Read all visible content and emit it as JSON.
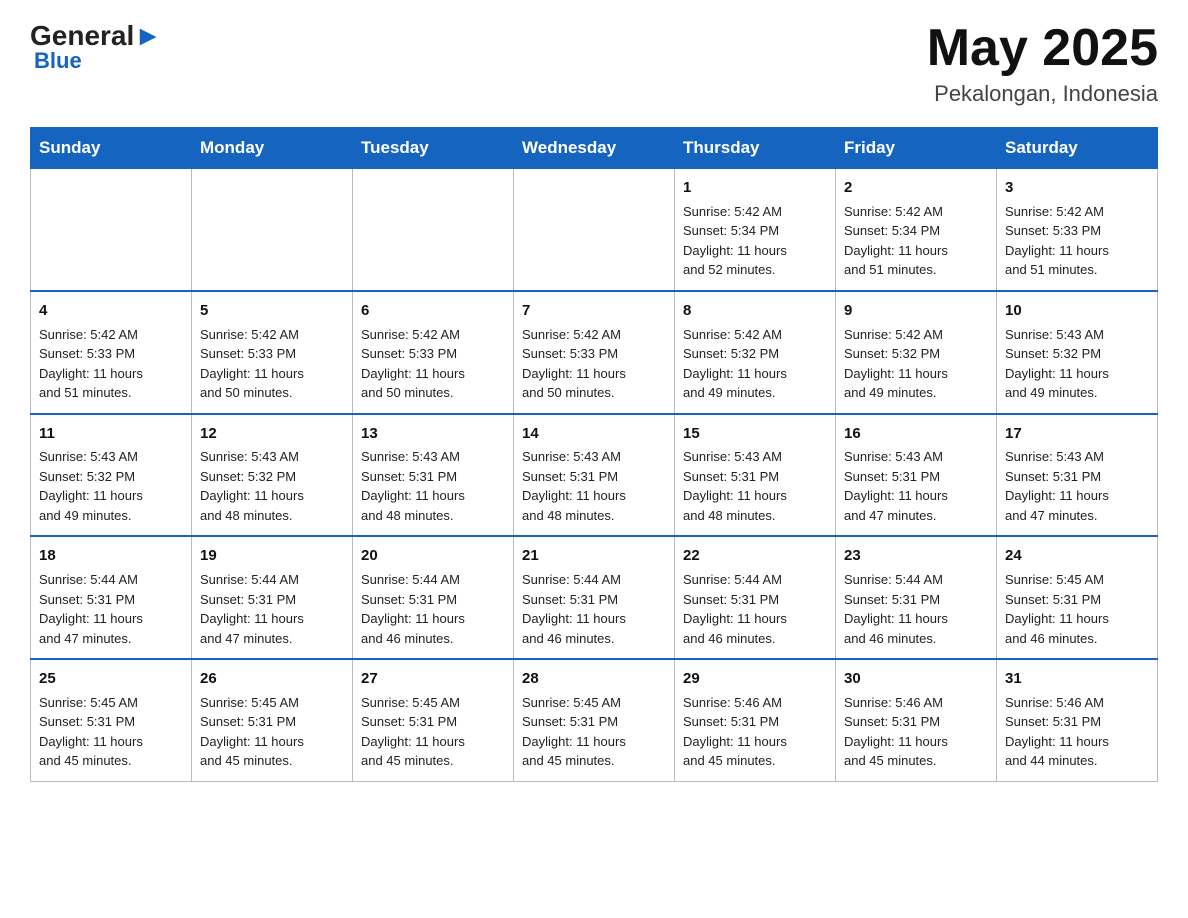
{
  "header": {
    "logo_general": "General",
    "logo_blue": "Blue",
    "month_title": "May 2025",
    "location": "Pekalongan, Indonesia"
  },
  "weekdays": [
    "Sunday",
    "Monday",
    "Tuesday",
    "Wednesday",
    "Thursday",
    "Friday",
    "Saturday"
  ],
  "weeks": [
    [
      {
        "day": "",
        "info": ""
      },
      {
        "day": "",
        "info": ""
      },
      {
        "day": "",
        "info": ""
      },
      {
        "day": "",
        "info": ""
      },
      {
        "day": "1",
        "info": "Sunrise: 5:42 AM\nSunset: 5:34 PM\nDaylight: 11 hours\nand 52 minutes."
      },
      {
        "day": "2",
        "info": "Sunrise: 5:42 AM\nSunset: 5:34 PM\nDaylight: 11 hours\nand 51 minutes."
      },
      {
        "day": "3",
        "info": "Sunrise: 5:42 AM\nSunset: 5:33 PM\nDaylight: 11 hours\nand 51 minutes."
      }
    ],
    [
      {
        "day": "4",
        "info": "Sunrise: 5:42 AM\nSunset: 5:33 PM\nDaylight: 11 hours\nand 51 minutes."
      },
      {
        "day": "5",
        "info": "Sunrise: 5:42 AM\nSunset: 5:33 PM\nDaylight: 11 hours\nand 50 minutes."
      },
      {
        "day": "6",
        "info": "Sunrise: 5:42 AM\nSunset: 5:33 PM\nDaylight: 11 hours\nand 50 minutes."
      },
      {
        "day": "7",
        "info": "Sunrise: 5:42 AM\nSunset: 5:33 PM\nDaylight: 11 hours\nand 50 minutes."
      },
      {
        "day": "8",
        "info": "Sunrise: 5:42 AM\nSunset: 5:32 PM\nDaylight: 11 hours\nand 49 minutes."
      },
      {
        "day": "9",
        "info": "Sunrise: 5:42 AM\nSunset: 5:32 PM\nDaylight: 11 hours\nand 49 minutes."
      },
      {
        "day": "10",
        "info": "Sunrise: 5:43 AM\nSunset: 5:32 PM\nDaylight: 11 hours\nand 49 minutes."
      }
    ],
    [
      {
        "day": "11",
        "info": "Sunrise: 5:43 AM\nSunset: 5:32 PM\nDaylight: 11 hours\nand 49 minutes."
      },
      {
        "day": "12",
        "info": "Sunrise: 5:43 AM\nSunset: 5:32 PM\nDaylight: 11 hours\nand 48 minutes."
      },
      {
        "day": "13",
        "info": "Sunrise: 5:43 AM\nSunset: 5:31 PM\nDaylight: 11 hours\nand 48 minutes."
      },
      {
        "day": "14",
        "info": "Sunrise: 5:43 AM\nSunset: 5:31 PM\nDaylight: 11 hours\nand 48 minutes."
      },
      {
        "day": "15",
        "info": "Sunrise: 5:43 AM\nSunset: 5:31 PM\nDaylight: 11 hours\nand 48 minutes."
      },
      {
        "day": "16",
        "info": "Sunrise: 5:43 AM\nSunset: 5:31 PM\nDaylight: 11 hours\nand 47 minutes."
      },
      {
        "day": "17",
        "info": "Sunrise: 5:43 AM\nSunset: 5:31 PM\nDaylight: 11 hours\nand 47 minutes."
      }
    ],
    [
      {
        "day": "18",
        "info": "Sunrise: 5:44 AM\nSunset: 5:31 PM\nDaylight: 11 hours\nand 47 minutes."
      },
      {
        "day": "19",
        "info": "Sunrise: 5:44 AM\nSunset: 5:31 PM\nDaylight: 11 hours\nand 47 minutes."
      },
      {
        "day": "20",
        "info": "Sunrise: 5:44 AM\nSunset: 5:31 PM\nDaylight: 11 hours\nand 46 minutes."
      },
      {
        "day": "21",
        "info": "Sunrise: 5:44 AM\nSunset: 5:31 PM\nDaylight: 11 hours\nand 46 minutes."
      },
      {
        "day": "22",
        "info": "Sunrise: 5:44 AM\nSunset: 5:31 PM\nDaylight: 11 hours\nand 46 minutes."
      },
      {
        "day": "23",
        "info": "Sunrise: 5:44 AM\nSunset: 5:31 PM\nDaylight: 11 hours\nand 46 minutes."
      },
      {
        "day": "24",
        "info": "Sunrise: 5:45 AM\nSunset: 5:31 PM\nDaylight: 11 hours\nand 46 minutes."
      }
    ],
    [
      {
        "day": "25",
        "info": "Sunrise: 5:45 AM\nSunset: 5:31 PM\nDaylight: 11 hours\nand 45 minutes."
      },
      {
        "day": "26",
        "info": "Sunrise: 5:45 AM\nSunset: 5:31 PM\nDaylight: 11 hours\nand 45 minutes."
      },
      {
        "day": "27",
        "info": "Sunrise: 5:45 AM\nSunset: 5:31 PM\nDaylight: 11 hours\nand 45 minutes."
      },
      {
        "day": "28",
        "info": "Sunrise: 5:45 AM\nSunset: 5:31 PM\nDaylight: 11 hours\nand 45 minutes."
      },
      {
        "day": "29",
        "info": "Sunrise: 5:46 AM\nSunset: 5:31 PM\nDaylight: 11 hours\nand 45 minutes."
      },
      {
        "day": "30",
        "info": "Sunrise: 5:46 AM\nSunset: 5:31 PM\nDaylight: 11 hours\nand 45 minutes."
      },
      {
        "day": "31",
        "info": "Sunrise: 5:46 AM\nSunset: 5:31 PM\nDaylight: 11 hours\nand 44 minutes."
      }
    ]
  ]
}
